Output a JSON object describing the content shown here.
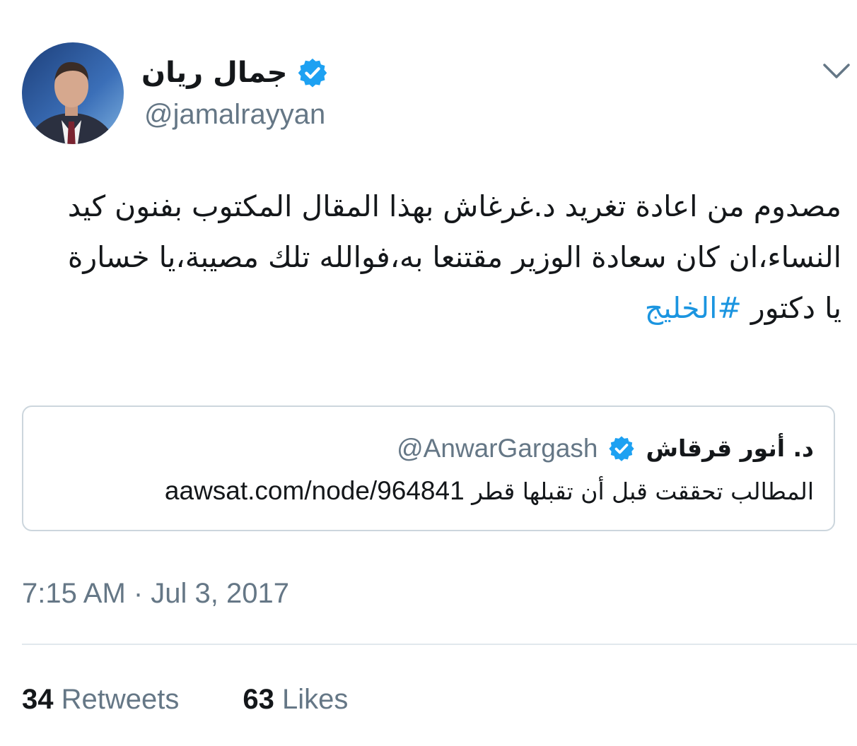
{
  "author": {
    "name": "جمال ريان",
    "handle": "@jamalrayyan",
    "verified": true,
    "avatar_icon": "profile-avatar"
  },
  "menu_icon": "chevron-down-icon",
  "tweet": {
    "text": "مصدوم من اعادة تغريد د.غرغاش بهذا المقال المكتوب بفنون كيد النساء،ان كان سعادة الوزير مقتنعا به،فوالله تلك مصيبة،يا خسارة يا دكتور ",
    "hashtag": "#الخليج"
  },
  "quoted_tweet": {
    "name": "د. أنور قرقاش",
    "handle": "@AnwarGargash",
    "verified": true,
    "text": "المطالب تحققت قبل أن تقبلها قطر",
    "url": "aawsat.com/node/964841"
  },
  "timestamp": "7:15 AM · Jul 3, 2017",
  "stats": {
    "retweets_count": "34",
    "retweets_label": "Retweets",
    "likes_count": "63",
    "likes_label": "Likes"
  },
  "colors": {
    "link_blue": "#1b95e0",
    "verified_blue": "#1da1f2",
    "muted_gray": "#657786",
    "border_gray": "#ccd6dd"
  }
}
